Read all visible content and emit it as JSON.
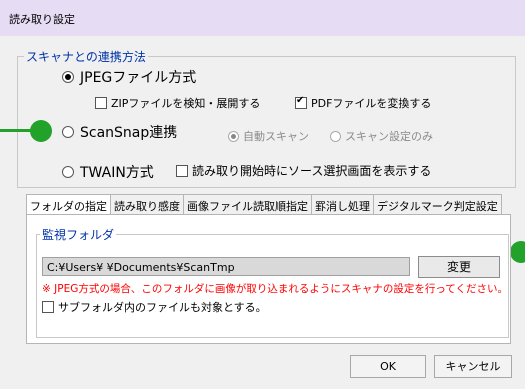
{
  "window": {
    "title": "読み取り設定"
  },
  "scanner_link": {
    "legend": "スキャナとの連携方法",
    "options": [
      {
        "label": "JPEGファイル方式",
        "selected": true
      },
      {
        "label": "ScanSnap連携",
        "selected": false
      },
      {
        "label": "TWAIN方式",
        "selected": false
      }
    ],
    "jpeg": {
      "zip_label": "ZIPファイルを検知・展開する",
      "zip_checked": false,
      "pdf_label": "PDFファイルを変換する",
      "pdf_checked": true
    },
    "scansnap": {
      "auto_label": "自動スキャン",
      "auto_selected": true,
      "settings_only_label": "スキャン設定のみ"
    },
    "twain": {
      "show_source_label": "読み取り開始時にソース選択画面を表示する",
      "checked": false
    }
  },
  "tabs": [
    "フォルダの指定",
    "読み取り感度",
    "画像ファイル読取順指定",
    "罫消し処理",
    "デジタルマーク判定設定"
  ],
  "active_tab": 0,
  "watch_folder": {
    "legend": "監視フォルダ",
    "path": "C:¥Users¥          ¥Documents¥ScanTmp",
    "change_button": "変更",
    "warning": "※ JPEG方式の場合、このフォルダに画像が取り込まれるようにスキャナの設定を行ってください。",
    "subfolder_label": "サブフォルダ内のファイルも対象とする。",
    "subfolder_checked": false
  },
  "footer": {
    "ok": "OK",
    "cancel": "キャンセル"
  },
  "colors": {
    "titlebar": "#e6dcf3",
    "legend": "#0033aa",
    "warning": "#ff0000",
    "marker": "#22a22a"
  }
}
